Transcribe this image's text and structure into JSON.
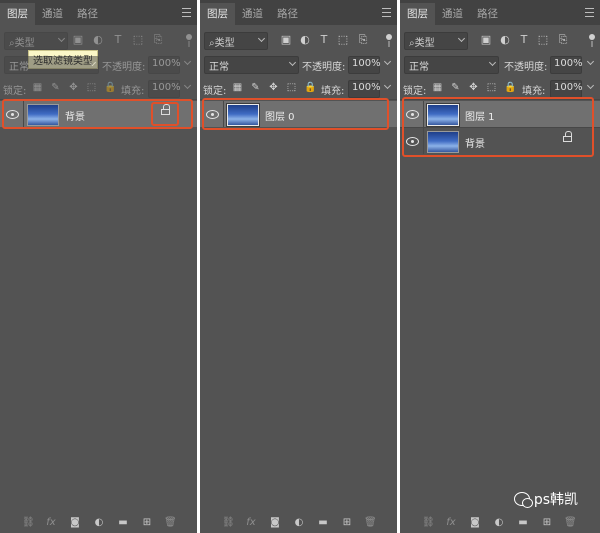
{
  "tabs": [
    "图层",
    "通道",
    "路径"
  ],
  "filter_type": "类型",
  "filter_tooltip": "选取滤镜类型",
  "blend_mode": "正常",
  "opacity_label": "不透明度:",
  "opacity_value": "100%",
  "lock_label": "锁定:",
  "fill_label": "填充:",
  "fill_value": "100%",
  "panels": [
    {
      "layers": [
        {
          "name": "背景",
          "selected": true,
          "locked": true
        }
      ]
    },
    {
      "layers": [
        {
          "name": "图层 0",
          "selected": true,
          "locked": false
        }
      ]
    },
    {
      "layers": [
        {
          "name": "图层 1",
          "selected": true,
          "locked": false
        },
        {
          "name": "背景",
          "selected": false,
          "locked": true
        }
      ]
    }
  ],
  "filter_icons": [
    "image-filter-icon",
    "adjustment-filter-icon",
    "type-filter-icon",
    "shape-filter-icon",
    "smart-object-filter-icon"
  ],
  "lock_icons": [
    "lock-transparent-icon",
    "lock-image-icon",
    "lock-position-icon",
    "lock-artboard-icon",
    "lock-all-icon"
  ],
  "bottom_icons": [
    "link-icon",
    "fx-icon",
    "mask-icon",
    "adjustment-icon",
    "folder-icon",
    "new-layer-icon",
    "trash-icon"
  ],
  "fx_label": "fx",
  "watermark": "ps韩凯",
  "colors": {
    "panel": "#535353",
    "tabbar": "#424242",
    "selected_layer": "#707070",
    "highlight": "#e0502a",
    "tooltip": "#fbf7c7"
  }
}
